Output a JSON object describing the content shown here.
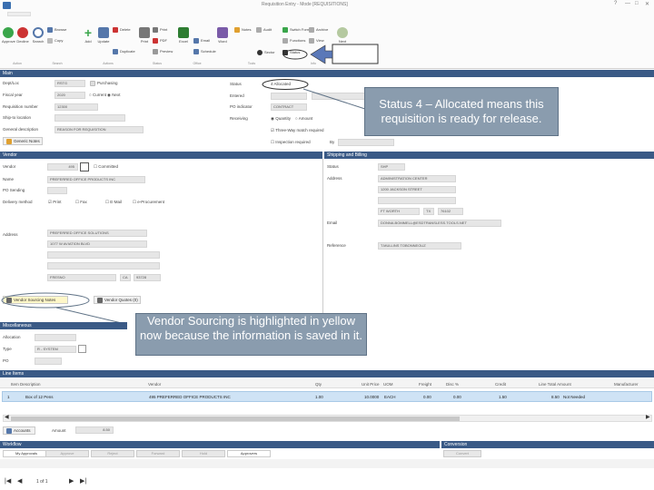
{
  "window": {
    "title": "Requisition Entry - Mode [REQUISITIONS]",
    "controls": [
      "?",
      "—",
      "□",
      "✕"
    ]
  },
  "ribbon": {
    "buttons": [
      {
        "label": "Approve",
        "icon": "approve-icon",
        "color": "#3aa64b"
      },
      {
        "label": "Decline",
        "icon": "decline-icon",
        "color": "#cc3333"
      },
      {
        "label": "Search",
        "icon": "search-icon",
        "color": "#5577aa"
      },
      {
        "label": "Add",
        "icon": "add-icon",
        "color": "#3aa64b"
      },
      {
        "label": "Update",
        "icon": "update-icon",
        "color": "#5577aa"
      },
      {
        "label": "Print",
        "icon": "print-icon",
        "color": "#666666"
      },
      {
        "label": "Excel",
        "icon": "excel-icon",
        "color": "#2e7d32"
      },
      {
        "label": "Word",
        "icon": "word-icon",
        "color": "#7a5ba8"
      },
      {
        "label": "Next",
        "icon": "next-icon",
        "color": "#3aa64b"
      }
    ],
    "small_items": [
      {
        "label": "Browse",
        "icon": "browse-icon",
        "color": "#5577aa"
      },
      {
        "label": "Copy",
        "icon": "copy-icon",
        "color": "#aaaaaa"
      },
      {
        "label": "Delete",
        "icon": "delete-icon",
        "color": "#cc3333"
      },
      {
        "label": "Duplicate",
        "icon": "duplicate-icon",
        "color": "#5577aa"
      },
      {
        "label": "Print",
        "icon": "print-small-icon",
        "color": "#666666"
      },
      {
        "label": "PDF",
        "icon": "pdf-icon",
        "color": "#cc3333"
      },
      {
        "label": "Preview",
        "icon": "preview-icon",
        "color": "#888888"
      },
      {
        "label": "Email",
        "icon": "email-icon",
        "color": "#5577aa"
      },
      {
        "label": "Schedule",
        "icon": "schedule-icon",
        "color": "#5577aa"
      },
      {
        "label": "Notes",
        "icon": "notes-icon",
        "color": "#e0a030"
      },
      {
        "label": "Audit",
        "icon": "audit-icon",
        "color": "#888888"
      },
      {
        "label": "Switch Form",
        "icon": "switch-form-icon",
        "color": "#3aa64b"
      },
      {
        "label": "Functions",
        "icon": "functions-icon",
        "color": "#888888"
      },
      {
        "label": "Sector",
        "icon": "sector-icon",
        "color": "#333333"
      },
      {
        "label": "Status",
        "icon": "status-icon",
        "color": "#333333"
      },
      {
        "label": "Archive",
        "icon": "archive-icon",
        "color": "#888888"
      },
      {
        "label": "View",
        "icon": "view-icon",
        "color": "#888888"
      }
    ],
    "groups": [
      "Action",
      "Search",
      "Actions",
      "Status",
      "Office",
      "Tools",
      "Info"
    ]
  },
  "main": {
    "section_title": "Main",
    "dept_loc_label": "Dept/Loc",
    "dept_loc_value": "RSTG",
    "purchasing_label": "Purchasing",
    "fiscal_year_label": "Fiscal year",
    "fiscal_year_value": "2020",
    "radio_current": "Current",
    "radio_next": "Next",
    "req_number_label": "Requisition number",
    "req_number_value": "12300",
    "ship_to_label": "Ship-to location",
    "general_desc_label": "General description",
    "general_desc_value": "REASON FOR REQUISITION",
    "generic_notes_button": "Generic Notes",
    "status_label": "Status",
    "status_value": "Allocated",
    "entered_label": "Entered",
    "po_indicator_label": "PO indicator",
    "po_indicator_value": "CONTRACT",
    "receiving_label": "Receiving",
    "radio_quantity": "Quantity",
    "radio_amount": "Amount",
    "three_way_label": "Three-Way match required",
    "inspection_label": "Inspection required",
    "by_label": "By"
  },
  "callouts": {
    "status": "Status 4 – Allocated means this requisition is ready for release.",
    "vendor": "Vendor Sourcing is highlighted in yellow now because the information is saved in it."
  },
  "vendor": {
    "section_title": "Vendor",
    "vendor_label": "Vendor",
    "vendor_value": "495",
    "committed_label": "Committed",
    "name_label": "Name",
    "name_value": "PREFERRED OFFICE PRODUCTS INC",
    "tip_label": "PO Sending",
    "delivery_label": "Delivery method",
    "opt_print": "Print",
    "opt_fax": "Fax",
    "opt_email": "E-Mail",
    "opt_eprocurement": "e-Procurement",
    "address_label": "Address",
    "address_lines": [
      "PREFERRED OFFICE SOLUTIONS",
      "1077 W AVIATION BLVD"
    ],
    "city_value": "FRESNO",
    "state_value": "CA",
    "zip_value": "93728",
    "vendor_sourcing_button": "Vendor Sourcing Notes",
    "vendor_quotes_button": "Vendor Quotes (0)"
  },
  "shipping": {
    "section_title": "Shipping and Billing",
    "status_label": "Status",
    "status_value": "SHP",
    "address_label": "Address",
    "address_lines": [
      "ADMINISTRATION CENTER",
      "1200 JACKSON STREET",
      "FT WORTH"
    ],
    "state_value": "TX",
    "zip_value": "76102",
    "email_label": "Email",
    "email_value": "DONNA.BOMMELL@ESDTRANSLESS.TOOLS.NET",
    "reference_label": "Reference",
    "reference_value": "T.MULLINS TOBONNEOUZ"
  },
  "miscellaneous": {
    "section_title": "Miscellaneous",
    "allocation_label": "Allocation",
    "type_label": "Type",
    "type_value": "R - SYSTEM",
    "po_label": "PO"
  },
  "line_items": {
    "section_title": "Line Items",
    "columns": [
      "Item Description",
      "Vendor",
      "Qty",
      "Unit Price",
      "UOM",
      "Freight",
      "Disc %",
      "Credit",
      "Line Total Amount",
      "Manufacturer"
    ],
    "rows": [
      {
        "num": "1",
        "desc": "Box of 12 Pens",
        "vendor": "495 PREFERRED OFFICE PRODUCTS INC",
        "qty": "1.00",
        "price": "10.0000",
        "uom": "EACH",
        "freight": "0.00",
        "disc": "0.00",
        "credit": "1.50",
        "total": "8.50",
        "mfr": "Not Needed"
      }
    ],
    "accounts_button": "Accounts",
    "amount_label": "Amount",
    "amount_value": "8.50"
  },
  "workflow": {
    "section_title": "Workflow",
    "tabs": [
      "My Approvals",
      "Approve",
      "Reject",
      "Forward",
      "Hold",
      "Approvers"
    ],
    "conversion_title": "Conversion",
    "convert_button": "Convert"
  },
  "pager": {
    "first": "|◀",
    "prev": "◀",
    "text": "1 of 1",
    "next": "▶",
    "last": "▶|"
  }
}
